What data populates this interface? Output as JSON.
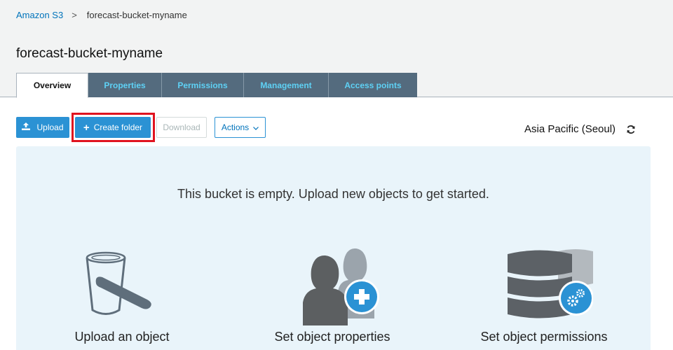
{
  "breadcrumb": {
    "root": "Amazon S3",
    "separator": ">",
    "current": "forecast-bucket-myname"
  },
  "page": {
    "title": "forecast-bucket-myname"
  },
  "tabs": [
    {
      "label": "Overview",
      "active": true
    },
    {
      "label": "Properties",
      "active": false
    },
    {
      "label": "Permissions",
      "active": false
    },
    {
      "label": "Management",
      "active": false
    },
    {
      "label": "Access points",
      "active": false
    }
  ],
  "toolbar": {
    "upload_label": "Upload",
    "create_folder_label": "Create folder",
    "download_label": "Download",
    "actions_label": "Actions"
  },
  "region": {
    "label": "Asia Pacific (Seoul)"
  },
  "empty_state": {
    "message": "This bucket is empty. Upload new objects to get started.",
    "features": [
      {
        "label": "Upload an object",
        "icon": "bucket-upload-icon"
      },
      {
        "label": "Set object properties",
        "icon": "users-plus-icon"
      },
      {
        "label": "Set object permissions",
        "icon": "database-gear-icon"
      }
    ]
  },
  "colors": {
    "primary_button": "#2b92d4",
    "tab_inactive_bg": "#546b7e",
    "tab_inactive_text": "#5ed1f5",
    "link": "#0073bb",
    "highlight": "#e0131f",
    "panel_bg": "#e9f4fa"
  }
}
